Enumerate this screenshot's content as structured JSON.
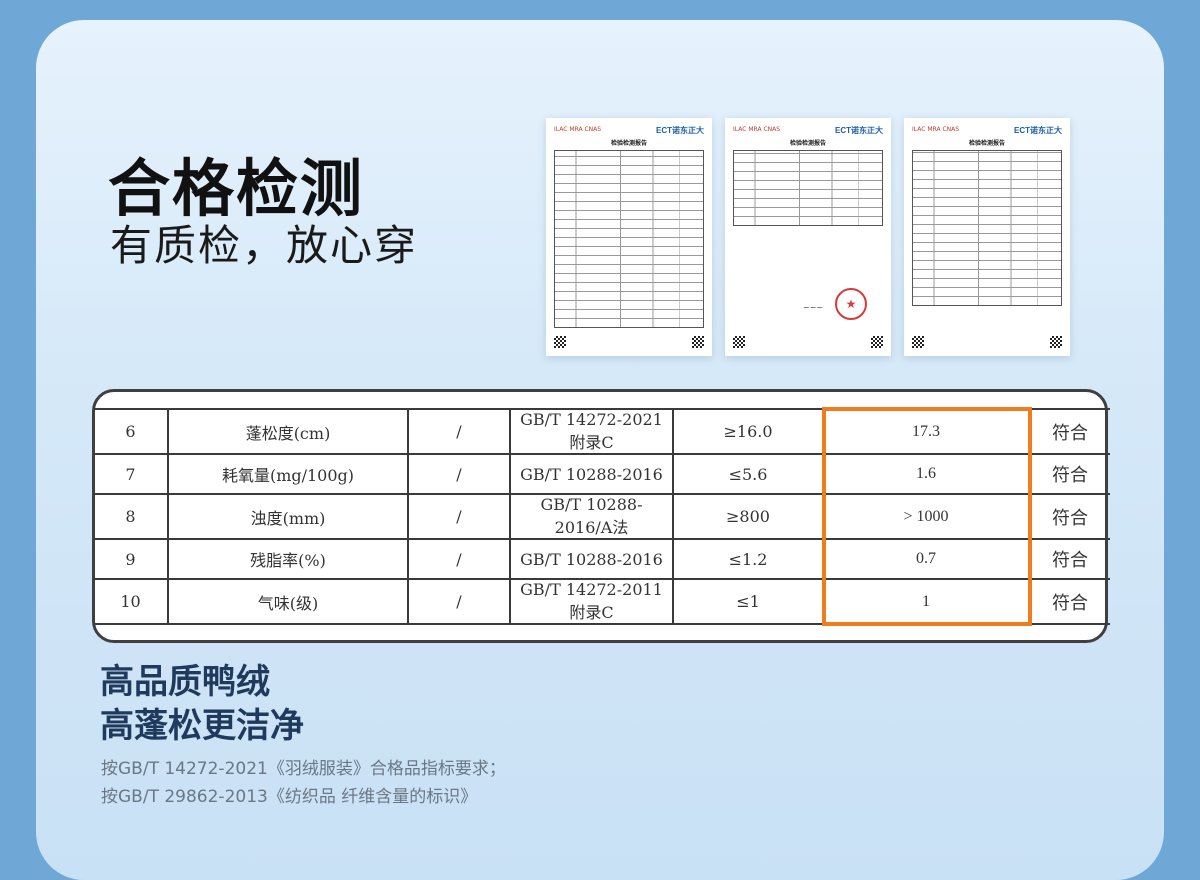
{
  "heading": {
    "title": "合格检测",
    "subtitle": "有质检，放心穿"
  },
  "reports": [
    {
      "logos": "ILAC MRA CNAS",
      "brand": "ECT诺东正大",
      "title": "检验检测报告"
    },
    {
      "logos": "ILAC MRA CNAS",
      "brand": "ECT诺东正大",
      "title": "检验检测报告"
    },
    {
      "logos": "ILAC MRA CNAS",
      "brand": "ECT诺东正大",
      "title": "检验检测报告"
    }
  ],
  "table": {
    "rows": [
      {
        "no": "6",
        "item": "蓬松度(cm)",
        "unit": "/",
        "standard": "GB/T 14272-2021 附录C",
        "requirement": "≥16.0",
        "result": "17.3",
        "conclusion": "符合"
      },
      {
        "no": "7",
        "item": "耗氧量(mg/100g)",
        "unit": "/",
        "standard": "GB/T 10288-2016",
        "requirement": "≤5.6",
        "result": "1.6",
        "conclusion": "符合"
      },
      {
        "no": "8",
        "item": "浊度(mm)",
        "unit": "/",
        "standard": "GB/T 10288-2016/A法",
        "requirement": "≥800",
        "result": "> 1000",
        "conclusion": "符合"
      },
      {
        "no": "9",
        "item": "残脂率(%)",
        "unit": "/",
        "standard": "GB/T 10288-2016",
        "requirement": "≤1.2",
        "result": "0.7",
        "conclusion": "符合"
      },
      {
        "no": "10",
        "item": "气味(级)",
        "unit": "/",
        "standard": "GB/T 14272-2011 附录C",
        "requirement": "≤1",
        "result": "1",
        "conclusion": "符合"
      }
    ]
  },
  "features": {
    "line1": "高品质鸭绒",
    "line2": "高蓬松更洁净"
  },
  "notes": {
    "line1": "按GB/T 14272-2021《羽绒服装》合格品指标要求；",
    "line2": "按GB/T 29862-2013《纺织品 纤维含量的标识》"
  },
  "colors": {
    "background": "#6fa8d6",
    "highlight": "#f07c1e",
    "heading_blue": "#1f3a5c"
  }
}
